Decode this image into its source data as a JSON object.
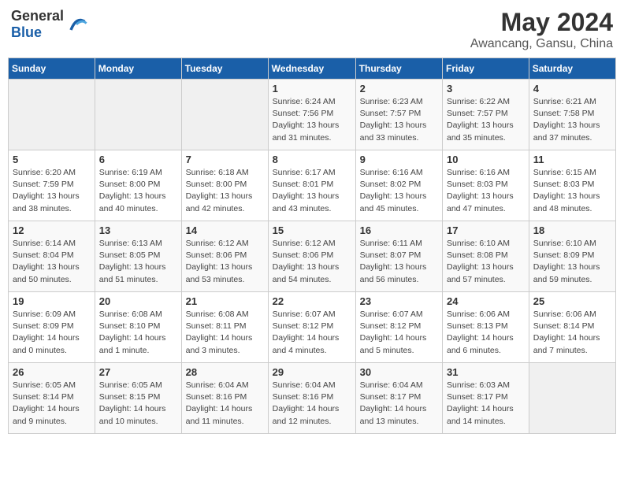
{
  "header": {
    "logo_general": "General",
    "logo_blue": "Blue",
    "title": "May 2024",
    "subtitle": "Awancang, Gansu, China"
  },
  "weekdays": [
    "Sunday",
    "Monday",
    "Tuesday",
    "Wednesday",
    "Thursday",
    "Friday",
    "Saturday"
  ],
  "weeks": [
    [
      {
        "day": "",
        "info": ""
      },
      {
        "day": "",
        "info": ""
      },
      {
        "day": "",
        "info": ""
      },
      {
        "day": "1",
        "info": "Sunrise: 6:24 AM\nSunset: 7:56 PM\nDaylight: 13 hours\nand 31 minutes."
      },
      {
        "day": "2",
        "info": "Sunrise: 6:23 AM\nSunset: 7:57 PM\nDaylight: 13 hours\nand 33 minutes."
      },
      {
        "day": "3",
        "info": "Sunrise: 6:22 AM\nSunset: 7:57 PM\nDaylight: 13 hours\nand 35 minutes."
      },
      {
        "day": "4",
        "info": "Sunrise: 6:21 AM\nSunset: 7:58 PM\nDaylight: 13 hours\nand 37 minutes."
      }
    ],
    [
      {
        "day": "5",
        "info": "Sunrise: 6:20 AM\nSunset: 7:59 PM\nDaylight: 13 hours\nand 38 minutes."
      },
      {
        "day": "6",
        "info": "Sunrise: 6:19 AM\nSunset: 8:00 PM\nDaylight: 13 hours\nand 40 minutes."
      },
      {
        "day": "7",
        "info": "Sunrise: 6:18 AM\nSunset: 8:00 PM\nDaylight: 13 hours\nand 42 minutes."
      },
      {
        "day": "8",
        "info": "Sunrise: 6:17 AM\nSunset: 8:01 PM\nDaylight: 13 hours\nand 43 minutes."
      },
      {
        "day": "9",
        "info": "Sunrise: 6:16 AM\nSunset: 8:02 PM\nDaylight: 13 hours\nand 45 minutes."
      },
      {
        "day": "10",
        "info": "Sunrise: 6:16 AM\nSunset: 8:03 PM\nDaylight: 13 hours\nand 47 minutes."
      },
      {
        "day": "11",
        "info": "Sunrise: 6:15 AM\nSunset: 8:03 PM\nDaylight: 13 hours\nand 48 minutes."
      }
    ],
    [
      {
        "day": "12",
        "info": "Sunrise: 6:14 AM\nSunset: 8:04 PM\nDaylight: 13 hours\nand 50 minutes."
      },
      {
        "day": "13",
        "info": "Sunrise: 6:13 AM\nSunset: 8:05 PM\nDaylight: 13 hours\nand 51 minutes."
      },
      {
        "day": "14",
        "info": "Sunrise: 6:12 AM\nSunset: 8:06 PM\nDaylight: 13 hours\nand 53 minutes."
      },
      {
        "day": "15",
        "info": "Sunrise: 6:12 AM\nSunset: 8:06 PM\nDaylight: 13 hours\nand 54 minutes."
      },
      {
        "day": "16",
        "info": "Sunrise: 6:11 AM\nSunset: 8:07 PM\nDaylight: 13 hours\nand 56 minutes."
      },
      {
        "day": "17",
        "info": "Sunrise: 6:10 AM\nSunset: 8:08 PM\nDaylight: 13 hours\nand 57 minutes."
      },
      {
        "day": "18",
        "info": "Sunrise: 6:10 AM\nSunset: 8:09 PM\nDaylight: 13 hours\nand 59 minutes."
      }
    ],
    [
      {
        "day": "19",
        "info": "Sunrise: 6:09 AM\nSunset: 8:09 PM\nDaylight: 14 hours\nand 0 minutes."
      },
      {
        "day": "20",
        "info": "Sunrise: 6:08 AM\nSunset: 8:10 PM\nDaylight: 14 hours\nand 1 minute."
      },
      {
        "day": "21",
        "info": "Sunrise: 6:08 AM\nSunset: 8:11 PM\nDaylight: 14 hours\nand 3 minutes."
      },
      {
        "day": "22",
        "info": "Sunrise: 6:07 AM\nSunset: 8:12 PM\nDaylight: 14 hours\nand 4 minutes."
      },
      {
        "day": "23",
        "info": "Sunrise: 6:07 AM\nSunset: 8:12 PM\nDaylight: 14 hours\nand 5 minutes."
      },
      {
        "day": "24",
        "info": "Sunrise: 6:06 AM\nSunset: 8:13 PM\nDaylight: 14 hours\nand 6 minutes."
      },
      {
        "day": "25",
        "info": "Sunrise: 6:06 AM\nSunset: 8:14 PM\nDaylight: 14 hours\nand 7 minutes."
      }
    ],
    [
      {
        "day": "26",
        "info": "Sunrise: 6:05 AM\nSunset: 8:14 PM\nDaylight: 14 hours\nand 9 minutes."
      },
      {
        "day": "27",
        "info": "Sunrise: 6:05 AM\nSunset: 8:15 PM\nDaylight: 14 hours\nand 10 minutes."
      },
      {
        "day": "28",
        "info": "Sunrise: 6:04 AM\nSunset: 8:16 PM\nDaylight: 14 hours\nand 11 minutes."
      },
      {
        "day": "29",
        "info": "Sunrise: 6:04 AM\nSunset: 8:16 PM\nDaylight: 14 hours\nand 12 minutes."
      },
      {
        "day": "30",
        "info": "Sunrise: 6:04 AM\nSunset: 8:17 PM\nDaylight: 14 hours\nand 13 minutes."
      },
      {
        "day": "31",
        "info": "Sunrise: 6:03 AM\nSunset: 8:17 PM\nDaylight: 14 hours\nand 14 minutes."
      },
      {
        "day": "",
        "info": ""
      }
    ]
  ]
}
